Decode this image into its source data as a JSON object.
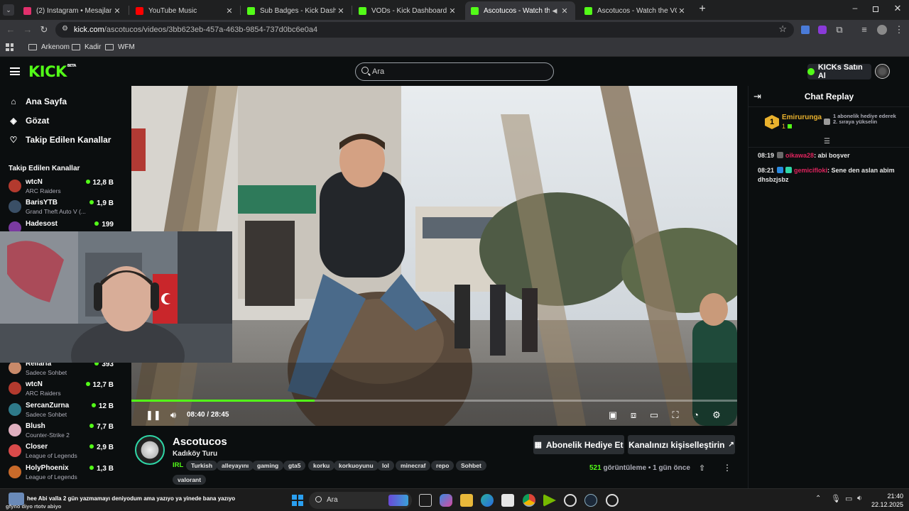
{
  "browser": {
    "tabs": [
      {
        "title": "(2) Instagram • Mesajlar",
        "color": "#e1306c"
      },
      {
        "title": "YouTube Music",
        "color": "#ff0000"
      },
      {
        "title": "Sub Badges - Kick Dashboard",
        "color": "#53fc18"
      },
      {
        "title": "VODs - Kick Dashboard",
        "color": "#53fc18"
      },
      {
        "title": "Ascotucos - Watch the VOD",
        "color": "#53fc18"
      },
      {
        "title": "Ascotucos - Watch the VOD on",
        "color": "#53fc18"
      }
    ],
    "url_host": "kick.com",
    "url_path": "/ascotucos/videos/3bb623eb-457a-463b-9854-737d0bc6e0a4",
    "bookmarks": [
      "Arkenom",
      "Kadir",
      "WFM"
    ]
  },
  "kick": {
    "logo": "KICK",
    "logo_badge": "BETA",
    "search_placeholder": "Ara",
    "kicks_button": "KICKs Satın Al",
    "brand_color": "#53fc18"
  },
  "sidebar": {
    "nav": [
      {
        "label": "Ana Sayfa",
        "icon": "home-icon"
      },
      {
        "label": "Gözat",
        "icon": "browse-icon"
      },
      {
        "label": "Takip Edilen Kanallar",
        "icon": "heart-icon"
      }
    ],
    "section_title": "Takip Edilen Kanallar",
    "channels_top": [
      {
        "name": "wtcN",
        "game": "ARC Raiders",
        "viewers": "12,8 B",
        "color": "#b33a2e"
      },
      {
        "name": "BarisYTB",
        "game": "Grand Theft Auto V (...",
        "viewers": "1,9 B",
        "color": "#3a4f66"
      },
      {
        "name": "Hadesost",
        "game": "",
        "viewers": "199",
        "color": "#7a3aa0"
      }
    ],
    "channels_bottom": [
      {
        "name": "Rellaria",
        "game": "Sadece Sohbet",
        "viewers": "393",
        "color": "#c98a6a"
      },
      {
        "name": "wtcN",
        "game": "ARC Raiders",
        "viewers": "12,7 B",
        "color": "#b33a2e"
      },
      {
        "name": "SercanZurna",
        "game": "Sadece Sohbet",
        "viewers": "12 B",
        "color": "#2e7a8a"
      },
      {
        "name": "Blush",
        "game": "Counter-Strike 2",
        "viewers": "7,7 B",
        "color": "#e0b0c0"
      },
      {
        "name": "Closer",
        "game": "League of Legends",
        "viewers": "2,9 B",
        "color": "#d84a4a"
      },
      {
        "name": "HolyPhoenix",
        "game": "League of Legends",
        "viewers": "1,3 B",
        "color": "#c86a2a"
      }
    ]
  },
  "player": {
    "time_current": "08:40",
    "time_total": "28:45",
    "progress_fraction": 0.302
  },
  "video_info": {
    "channel_name": "Ascotucos",
    "title": "Kadıköy Turu",
    "category": "IRL",
    "tags": [
      "Turkish",
      "alleyayını",
      "gaming",
      "gta5",
      "korku",
      "korkuoyunu",
      "lol",
      "minecraf",
      "repo",
      "Sohbet",
      "valorant"
    ],
    "gift_button": "Abonelik Hediye Et",
    "customize_button": "Kanalınızı kişiselleştirin",
    "views_count": "521",
    "views_label": "görüntüleme",
    "time_ago": "1 gün önce"
  },
  "chat": {
    "title": "Chat Replay",
    "pinned_rank": "1",
    "pinned_user": "Emirurunga",
    "pinned_count": "1",
    "pinned_text": "1 abonelik hediye ederek 2. sıraya yükselin",
    "messages": [
      {
        "time": "08:19",
        "user": "oikawa28",
        "text": "abi boşver",
        "color": "#e0245e"
      },
      {
        "time": "08:21",
        "user": "gemicifloki",
        "text": "Sene den aslan abim dhsbzjsbz",
        "color": "#e0245e"
      }
    ]
  },
  "taskbar": {
    "notification_text": "hee Abi valla 2 gün yazmamayı deniyodum ama yazıyo ya yinede bana yazıyo",
    "notification_sub": "gfyno diyo rtotv abiyo",
    "search_label": "Ara",
    "time": "21:40",
    "date": "22.12.2025"
  }
}
